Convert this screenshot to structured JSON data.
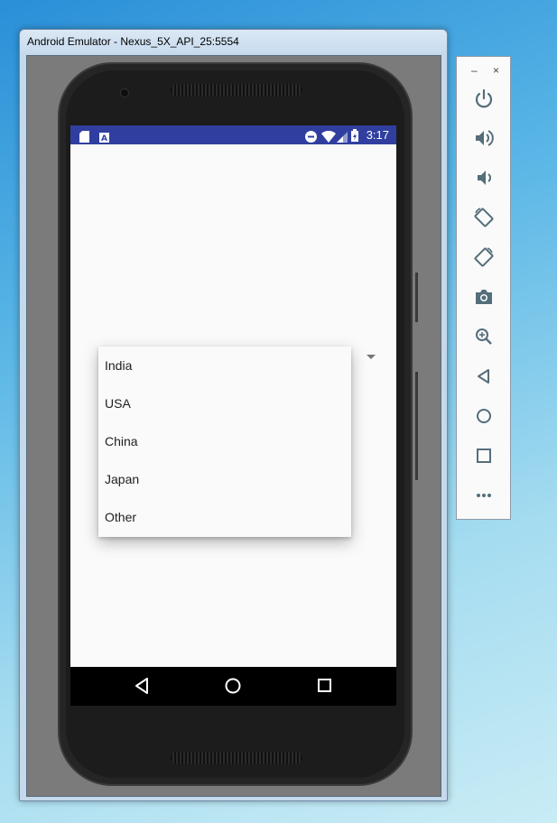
{
  "window": {
    "title": "Android Emulator - Nexus_5X_API_25:5554"
  },
  "statusbar": {
    "time": "3:17"
  },
  "dropdown": {
    "options": [
      "India",
      "USA",
      "China",
      "Japan",
      "Other"
    ]
  },
  "toolbar": {
    "minimize_label": "–",
    "close_label": "×",
    "buttons": [
      "power-icon",
      "volume-up-icon",
      "volume-down-icon",
      "rotate-left-icon",
      "rotate-right-icon",
      "camera-icon",
      "zoom-icon",
      "back-icon",
      "home-icon",
      "overview-icon",
      "more-icon"
    ]
  },
  "colors": {
    "statusbar": "#303f9f",
    "screen_background": "#fafafa",
    "toolbar_icon": "#546e7a"
  }
}
